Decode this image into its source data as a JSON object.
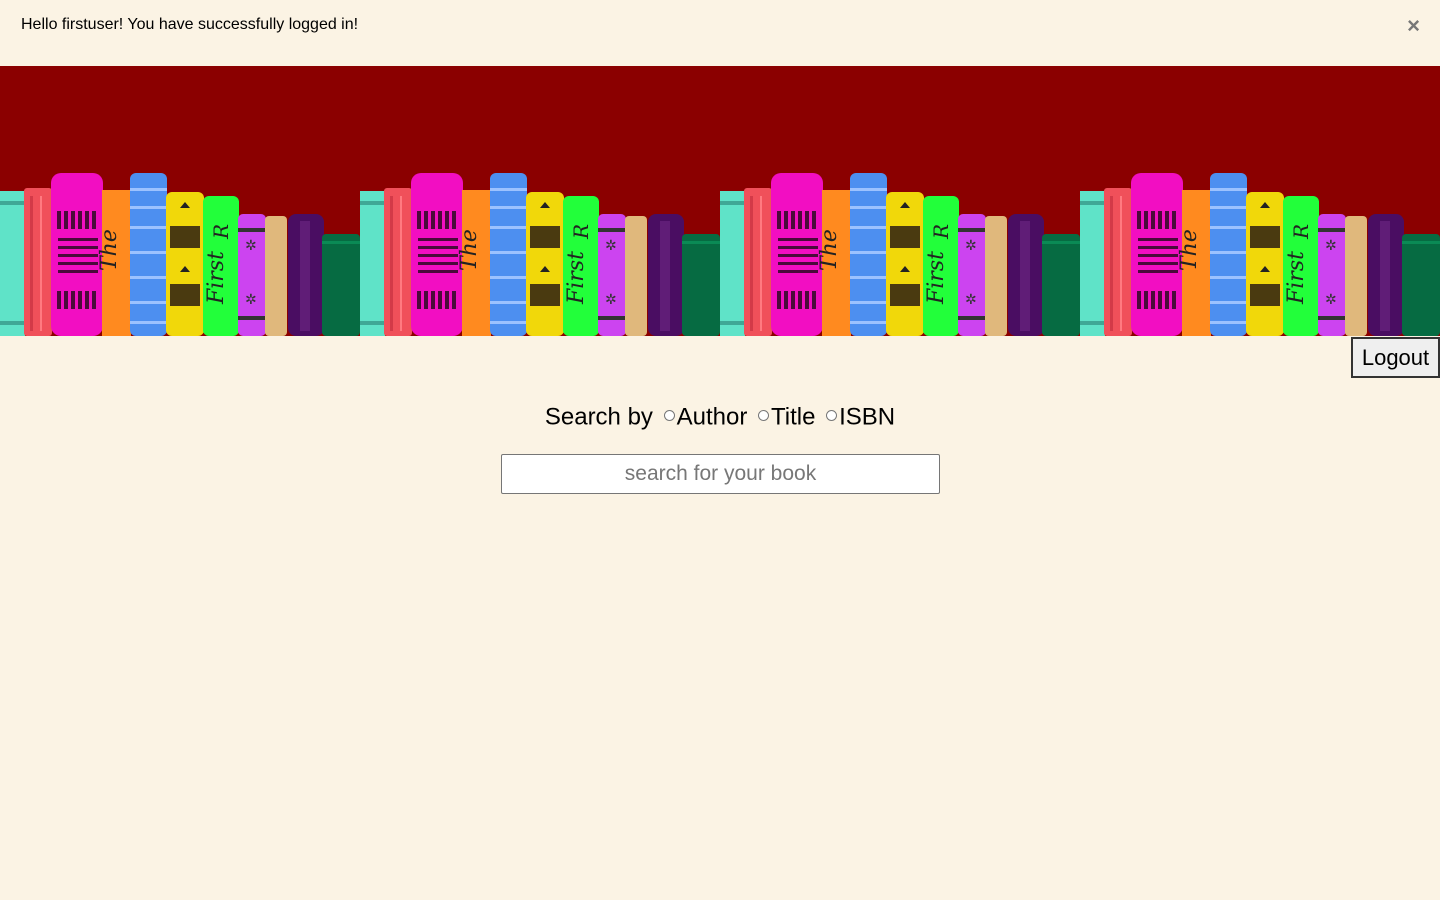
{
  "flash": {
    "message": "Hello firstuser! You have successfully logged in!",
    "close_symbol": "×"
  },
  "banner": {
    "background": "#8b0000",
    "spine_text": [
      "The",
      "First",
      "R"
    ]
  },
  "header": {
    "logout_label": "Logout"
  },
  "search": {
    "by_label": "Search by",
    "options": [
      {
        "label": "Author",
        "value": "author"
      },
      {
        "label": "Title",
        "value": "title"
      },
      {
        "label": "ISBN",
        "value": "isbn"
      }
    ],
    "placeholder": "search for your book"
  }
}
